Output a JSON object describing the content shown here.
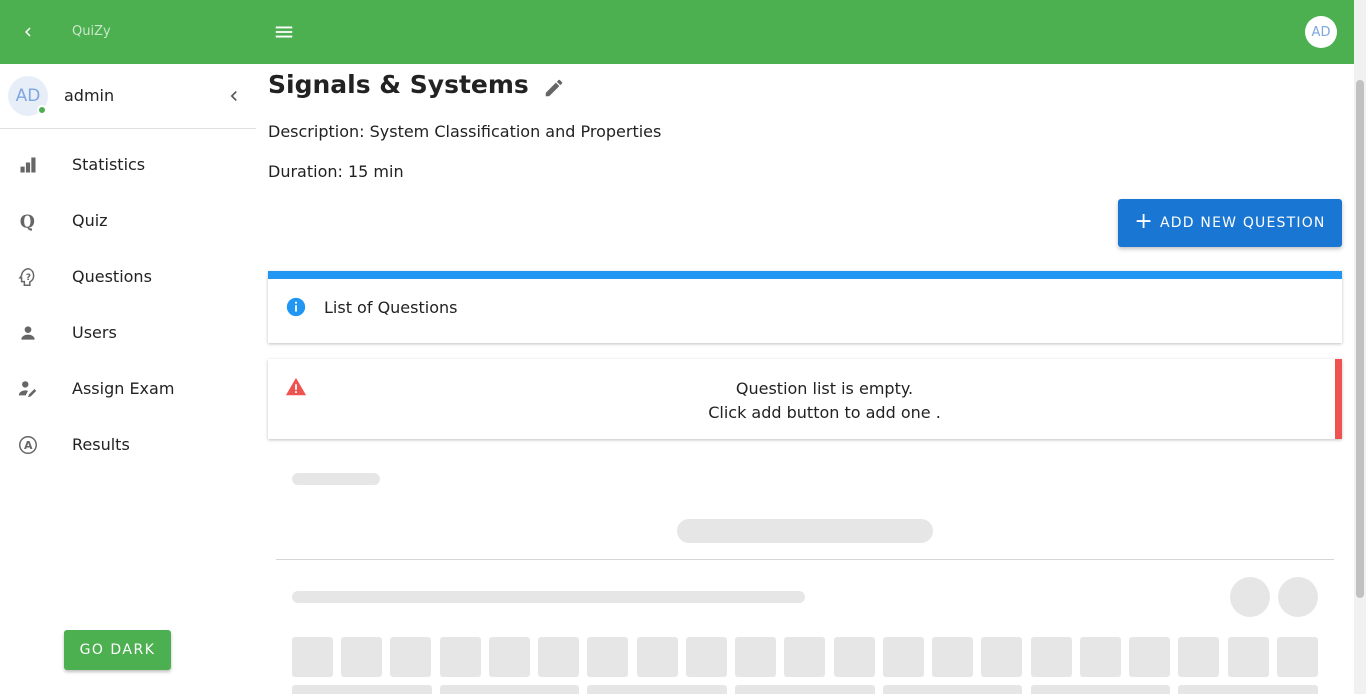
{
  "app": {
    "brand": "QuiZy",
    "avatar_initials": "AD"
  },
  "sidebar": {
    "user": {
      "initials": "AD",
      "name": "admin"
    },
    "items": [
      {
        "label": "Statistics",
        "icon": "bar-chart-icon"
      },
      {
        "label": "Quiz",
        "icon": "quiz-q-icon"
      },
      {
        "label": "Questions",
        "icon": "question-head-icon"
      },
      {
        "label": "Users",
        "icon": "user-icon"
      },
      {
        "label": "Assign Exam",
        "icon": "user-edit-icon"
      },
      {
        "label": "Results",
        "icon": "results-a-icon"
      }
    ],
    "theme_button": "GO DARK"
  },
  "main": {
    "title": "Signals & Systems",
    "description": "Description: System Classification and Properties",
    "duration": "Duration: 15 min",
    "add_button": "ADD NEW QUESTION",
    "info_banner": "List of Questions",
    "empty_line1": "Question list is empty.",
    "empty_line2": "Click add button to add one ."
  },
  "colors": {
    "primary_green": "#4caf50",
    "primary_blue": "#1976d2",
    "info_blue": "#2196f3",
    "error_red": "#ef5350"
  }
}
